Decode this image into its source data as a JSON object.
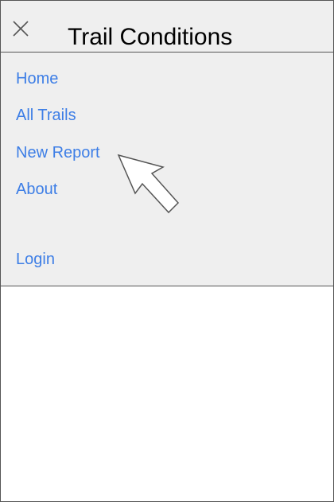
{
  "colors": {
    "link": "#3d7ee6",
    "panel_bg": "#efefef",
    "border": "#555555"
  },
  "header": {
    "close_icon": "close-icon",
    "title": "Trail Conditions"
  },
  "nav": {
    "items": [
      {
        "label": "Home"
      },
      {
        "label": "All Trails"
      },
      {
        "label": "New Report"
      },
      {
        "label": "About"
      },
      {
        "label": "Login"
      }
    ]
  },
  "cursor_icon": "arrow-cursor-icon"
}
